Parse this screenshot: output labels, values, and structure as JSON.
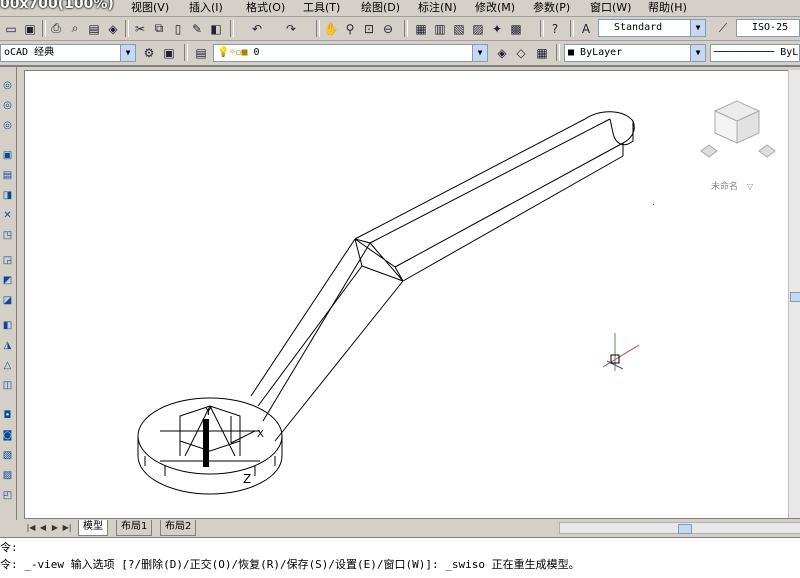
{
  "app": {
    "title_overlay": "00x700(100%)"
  },
  "menu": {
    "items": [
      {
        "label": "视图(V)"
      },
      {
        "label": "插入(I)"
      },
      {
        "label": "格式(O)"
      },
      {
        "label": "工具(T)"
      },
      {
        "label": "绘图(D)"
      },
      {
        "label": "标注(N)"
      },
      {
        "label": "修改(M)"
      },
      {
        "label": "参数(P)"
      },
      {
        "label": "窗口(W)"
      },
      {
        "label": "帮助(H)"
      }
    ]
  },
  "toolbar": {
    "text_style": "Standard",
    "dim_style": "ISO-25",
    "workspace": "oCAD 经典",
    "layer": "0",
    "color": "ByLayer",
    "linetype": "ByLay"
  },
  "icons": {
    "new": "new-file-icon",
    "save": "save-icon",
    "print": "print-icon",
    "cut": "cut-icon",
    "copy": "copy-icon",
    "paste": "paste-icon",
    "undo": "undo-icon",
    "redo": "redo-icon",
    "pan": "pan-hand-icon",
    "zoom": "zoom-icon",
    "properties": "properties-icon",
    "help": "help-icon"
  },
  "viewcube": {
    "label": "未命名"
  },
  "ucs": {
    "x": "X",
    "y": "Y",
    "z": "Z"
  },
  "tabs": [
    {
      "label": "模型",
      "active": true
    },
    {
      "label": "布局1",
      "active": false
    },
    {
      "label": "布局2",
      "active": false
    }
  ],
  "command": {
    "line1": "令:",
    "line2": "令: _-view 输入选项 [?/删除(D)/正交(O)/恢复(R)/保存(S)/设置(E)/窗口(W)]: _swiso 正在重生成模型。"
  },
  "colors": {
    "canvas_bg": "#ffffff",
    "ui_bg": "#d4d0c8",
    "accent": "#0a4a9a"
  }
}
